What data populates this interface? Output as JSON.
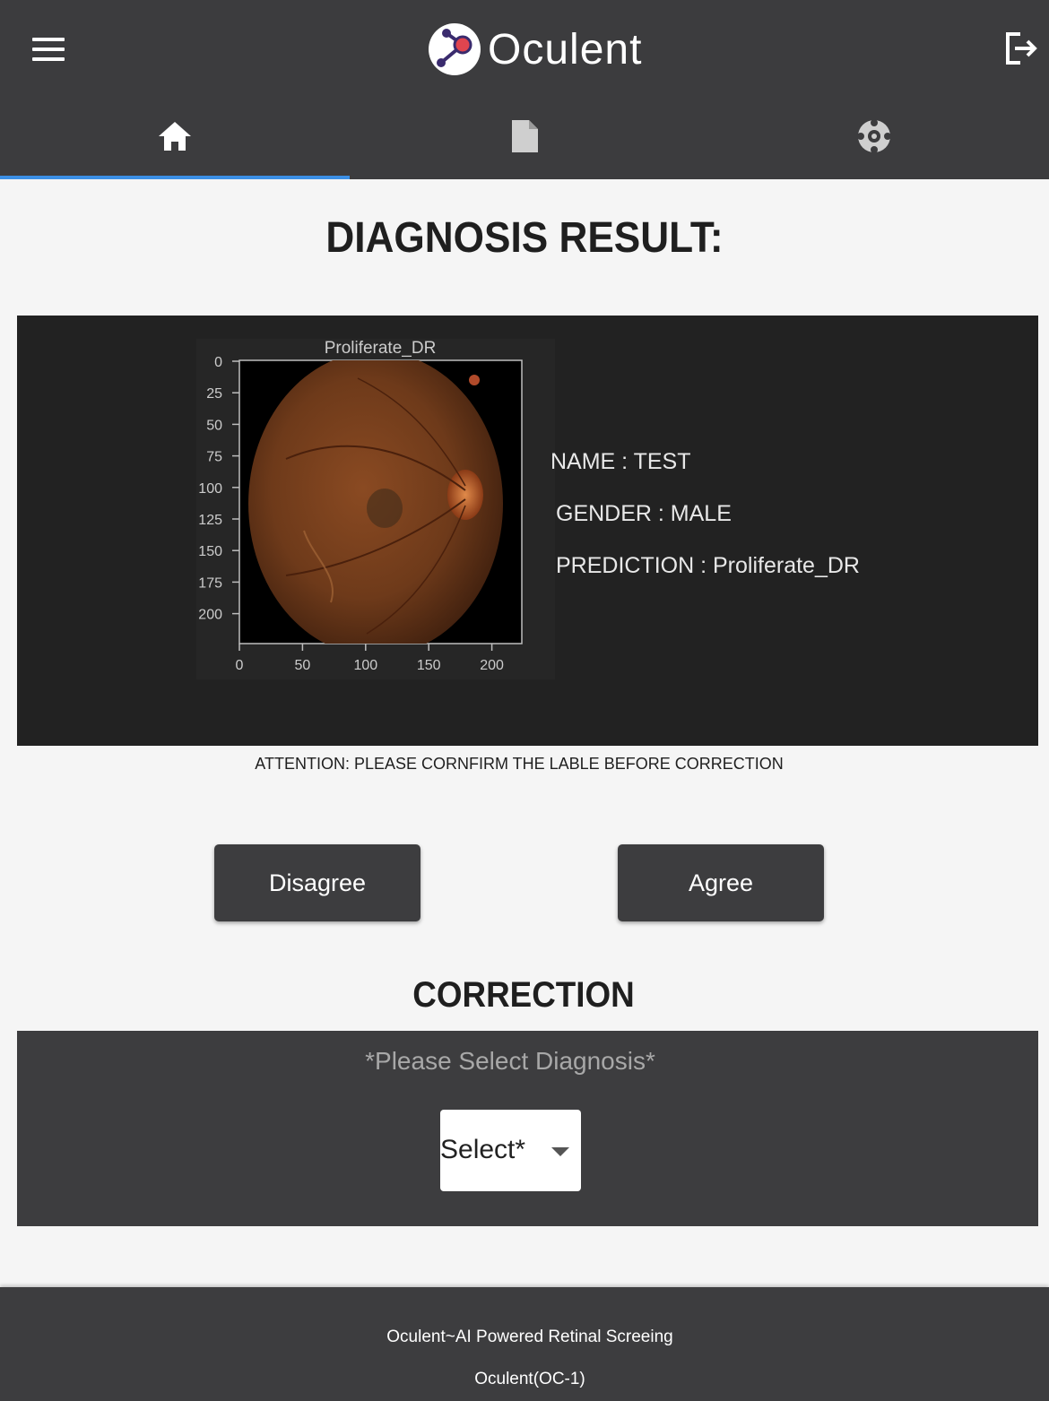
{
  "app": {
    "name": "Oculent"
  },
  "tabs": [
    {
      "id": "home",
      "icon": "home-icon",
      "active": true
    },
    {
      "id": "reports",
      "icon": "document-icon",
      "active": false
    },
    {
      "id": "help",
      "icon": "lifebuoy-icon",
      "active": false
    }
  ],
  "page": {
    "title": "DIAGNOSIS RESULT:"
  },
  "result": {
    "image_title": "Proliferate_DR",
    "y_ticks": [
      "0",
      "25",
      "50",
      "75",
      "100",
      "125",
      "150",
      "175",
      "200"
    ],
    "x_ticks": [
      "0",
      "50",
      "100",
      "150",
      "200"
    ],
    "name_text": "NAME : TEST",
    "gender_text": "GENDER : MALE",
    "prediction_text": "PREDICTION : Proliferate_DR"
  },
  "attention_text": "ATTENTION: PLEASE CORNFIRM THE LABLE BEFORE CORRECTION",
  "buttons": {
    "disagree": "Disagree",
    "agree": "Agree"
  },
  "correction": {
    "title": "CORRECTION",
    "prompt": "*Please Select Diagnosis*",
    "select_value": "Select*"
  },
  "footer": {
    "line1": "Oculent~AI Powered Retinal Screeing",
    "line2": "Oculent(OC-1)"
  },
  "colors": {
    "appbar": "#3c3c3e",
    "tab_indicator": "#3b8fe5",
    "panel_dark": "#222222",
    "panel_gray": "#3d3d3f",
    "logo_accent": "#e0454f"
  }
}
